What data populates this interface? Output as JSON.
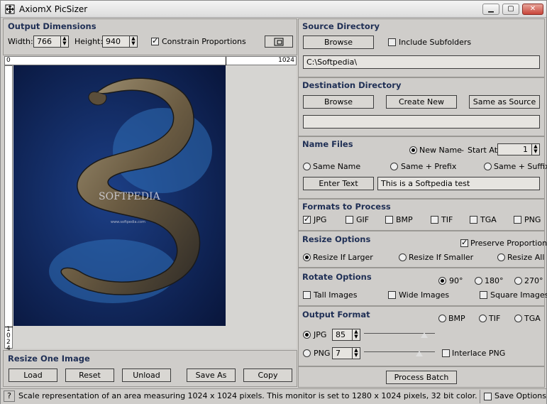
{
  "window": {
    "title": "AxiomX PicSizer"
  },
  "output_dimensions": {
    "header": "Output Dimensions",
    "width_label": "Width:",
    "width_value": "766",
    "height_label": "Height:",
    "height_value": "940",
    "constrain_label": "Constrain Proportions",
    "constrain_checked": true
  },
  "ruler": {
    "zero": "0",
    "max": "1024",
    "v_labels": [
      "1",
      "0",
      "2",
      "4"
    ]
  },
  "preview": {
    "watermark": "SOFTPEDIA",
    "url": "www.softpedia.com"
  },
  "resize_one": {
    "header": "Resize One Image",
    "buttons": [
      "Load",
      "Reset",
      "Unload",
      "Save As",
      "Copy"
    ]
  },
  "status": {
    "help": "?",
    "text": "Scale representation of an area measuring 1024 x 1024 pixels. This monitor is set to 1280 x 1024 pixels, 32 bit color.",
    "save_options": "Save Options"
  },
  "source": {
    "header": "Source Directory",
    "browse": "Browse",
    "include_sub": "Include Subfolders",
    "path": "C:\\Softpedia\\"
  },
  "destination": {
    "header": "Destination Directory",
    "browse": "Browse",
    "create_new": "Create New",
    "same_as_source": "Same as Source",
    "path": ""
  },
  "name_files": {
    "header": "Name Files",
    "new_name": "New Name",
    "start_at_sep": "-",
    "start_at": "Start At:",
    "start_value": "1",
    "same_name": "Same Name",
    "same_prefix": "Same + Prefix",
    "same_suffix": "Same + Suffix",
    "enter_text": "Enter Text",
    "text_value": "This is a Softpedia test"
  },
  "formats": {
    "header": "Formats to Process",
    "items": [
      {
        "label": "JPG",
        "checked": true
      },
      {
        "label": "GIF",
        "checked": false
      },
      {
        "label": "BMP",
        "checked": false
      },
      {
        "label": "TIF",
        "checked": false
      },
      {
        "label": "TGA",
        "checked": false
      },
      {
        "label": "PNG",
        "checked": false
      }
    ]
  },
  "resize_options": {
    "header": "Resize Options",
    "preserve": "Preserve Proportions",
    "if_larger": "Resize If Larger",
    "if_smaller": "Resize If Smaller",
    "all": "Resize All"
  },
  "rotate_options": {
    "header": "Rotate Options",
    "r90": "90°",
    "r180": "180°",
    "r270": "270°",
    "tall": "Tall Images",
    "wide": "Wide Images",
    "square": "Square Images"
  },
  "output_format": {
    "header": "Output Format",
    "bmp": "BMP",
    "tif": "TIF",
    "tga": "TGA",
    "jpg": "JPG",
    "jpg_quality": "85",
    "jpg_slider": 0.85,
    "png": "PNG",
    "png_level": "7",
    "png_slider": 0.78,
    "interlace": "Interlace PNG"
  },
  "process": "Process Batch"
}
